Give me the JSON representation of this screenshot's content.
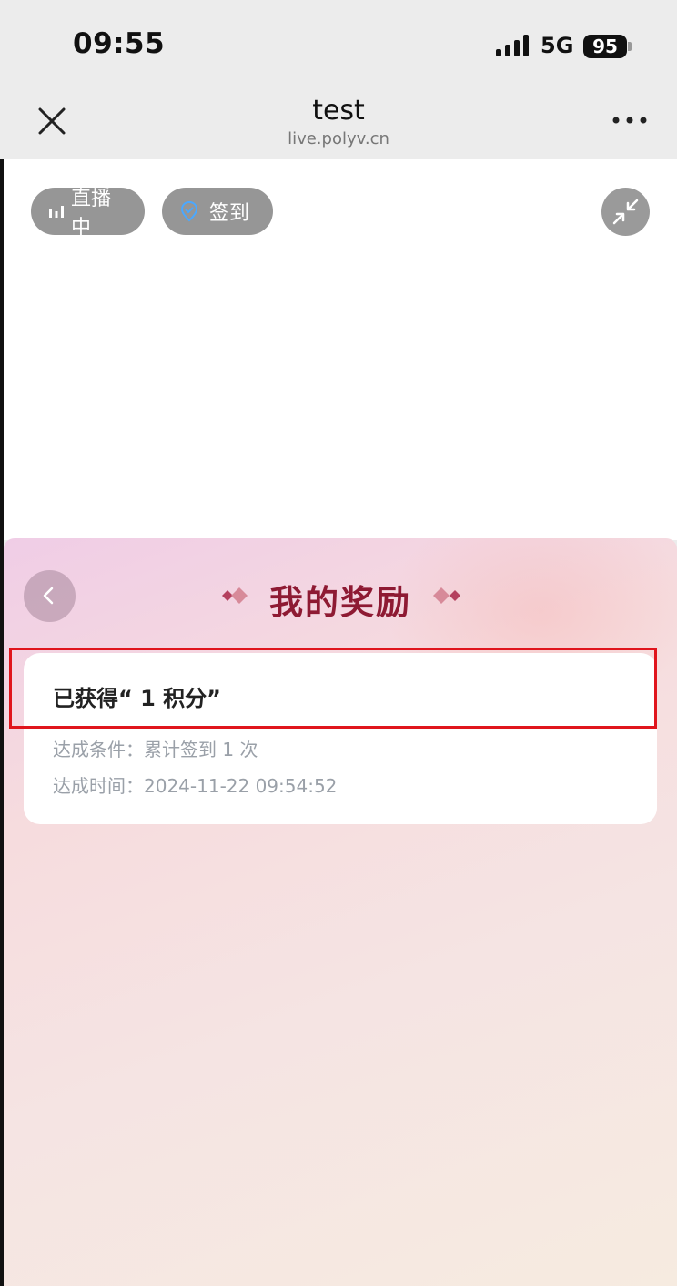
{
  "status_bar": {
    "time": "09:55",
    "network": "5G",
    "battery": "95"
  },
  "nav": {
    "title": "test",
    "subtitle": "live.polyv.cn"
  },
  "player": {
    "live_label": "直播中",
    "checkin_label": "签到"
  },
  "rewards": {
    "title": "我的奖励",
    "item": {
      "heading": "已获得“ 1 积分”",
      "condition": "达成条件：累计签到 1 次",
      "time": "达成时间：2024-11-22 09:54:52"
    }
  },
  "colors": {
    "title_red": "#8e1a33",
    "highlight_red": "#e0151d",
    "checkin_icon_blue": "#4aa8ff"
  }
}
